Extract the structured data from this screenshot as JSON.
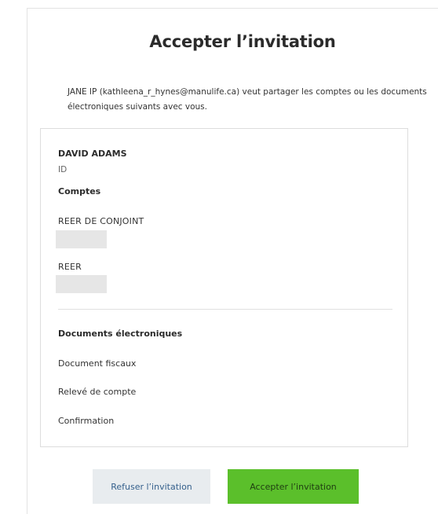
{
  "dialog": {
    "title": "Accepter l’invitation",
    "intro": "JANE IP (kathleena_r_hynes@manulife.ca) veut partager les comptes ou les documents électroniques suivants avec vous."
  },
  "card": {
    "owner_name": "DAVID ADAMS",
    "owner_id_label": "ID",
    "accounts_heading": "Comptes",
    "accounts": [
      {
        "label": "REER DE CONJOINT"
      },
      {
        "label": "REER"
      }
    ],
    "documents_heading": "Documents électroniques",
    "documents": [
      {
        "label": "Document fiscaux"
      },
      {
        "label": "Relevé de compte"
      },
      {
        "label": "Confirmation"
      }
    ]
  },
  "actions": {
    "decline_label": "Refuser l’invitation",
    "accept_label": "Accepter l’invitation"
  },
  "colors": {
    "accept_button": "#5bbf2b",
    "decline_button": "#e8ecef",
    "decline_text": "#35608c"
  }
}
